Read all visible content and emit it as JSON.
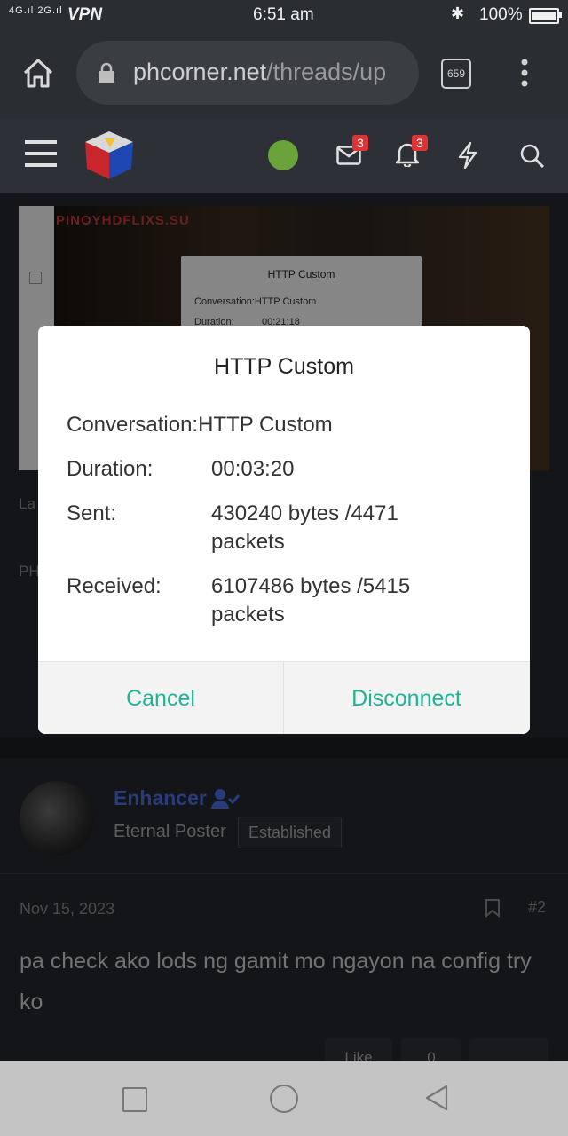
{
  "status_bar": {
    "network_left": "4G",
    "network_right": "2G",
    "vpn": "VPN",
    "time": "6:51 am",
    "battery": "100%",
    "icons": [
      "signal-icon",
      "bluetooth-icon",
      "battery-icon"
    ]
  },
  "browser": {
    "url_domain": "phcorner.net",
    "url_path": "/threads/up",
    "tab_count": "659",
    "icons": [
      "home-icon",
      "lock-icon",
      "tabs-icon",
      "more-vert-icon"
    ]
  },
  "site_header": {
    "message_badge": "3",
    "alert_badge": "3",
    "icons": [
      "menu-icon",
      "phcorner-logo",
      "android-avatar",
      "mail-icon",
      "bell-icon",
      "lightning-icon",
      "search-icon"
    ]
  },
  "embedded_screenshot": {
    "watermark": "PINOYHDFLIXS.SU",
    "dialog_title": "HTTP Custom",
    "conversation": "Conversation:HTTP Custom",
    "duration_label": "Duration:",
    "duration_value": "00:21:18"
  },
  "background_fragments": {
    "la": "La",
    "ph": "PH"
  },
  "dialog": {
    "title": "HTTP Custom",
    "conversation_label": "Conversation:",
    "conversation_value": "HTTP Custom",
    "duration_label": "Duration:",
    "duration_value": "00:03:20",
    "sent_label": "Sent:",
    "sent_value": "430240 bytes /4471 packets",
    "received_label": "Received:",
    "received_value": "6107486 bytes /5415 packets",
    "cancel": "Cancel",
    "disconnect": "Disconnect",
    "accent": "#1fb594"
  },
  "post": {
    "username": "Enhancer",
    "user_title": "Eternal Poster",
    "badge": "Established",
    "date": "Nov 15, 2023",
    "post_number": "#2",
    "body": "pa check ako lods ng gamit mo ngayon na config try ko",
    "like_label": "Like",
    "reaction_count": "0",
    "username_color": "#4a6ee0"
  }
}
